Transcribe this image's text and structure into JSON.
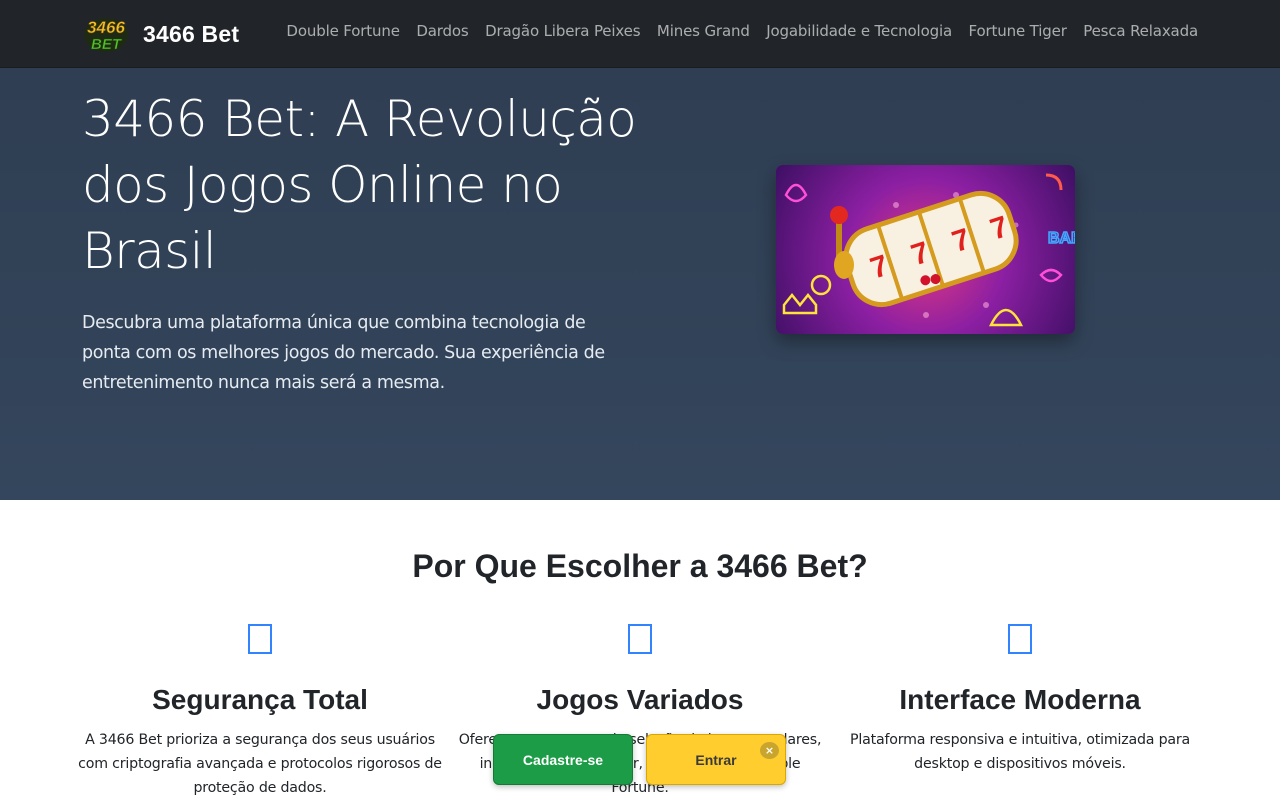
{
  "brand": {
    "logo_text": "3466 BET",
    "name": "3466 Bet"
  },
  "nav": {
    "links": [
      "Double Fortune",
      "Dardos",
      "Dragão Libera Peixes",
      "Mines Grand",
      "Jogabilidade e Tecnologia",
      "Fortune Tiger",
      "Pesca Relaxada"
    ]
  },
  "hero": {
    "title": "3466 Bet: A Revolução dos Jogos Online no Brasil",
    "text": "Descubra uma plataforma única que combina tecnologia de ponta com os melhores jogos do mercado. Sua experiência de entretenimento nunca mais será a mesma."
  },
  "features": {
    "title": "Por Que Escolher a 3466 Bet?",
    "items": [
      {
        "icon": "shield-icon",
        "title": "Segurança Total",
        "desc": "A 3466 Bet prioriza a segurança dos seus usuários com criptografia avançada e protocolos rigorosos de proteção de dados."
      },
      {
        "icon": "controller-icon",
        "title": "Jogos Variados",
        "desc": "Oferecemos uma ampla seleção de jogos populares, incluindo Fortune Tiger, Mines Grand e Double Fortune."
      },
      {
        "icon": "monitor-icon",
        "title": "Interface Moderna",
        "desc": "Plataforma responsiva e intuitiva, otimizada para desktop e dispositivos móveis."
      }
    ]
  },
  "cta": {
    "register": "Cadastre-se",
    "login": "Entrar",
    "close": "×"
  },
  "colors": {
    "navbar": "#212529",
    "hero": "#34465d",
    "register": "#1c9c46",
    "login": "#ffcd2e",
    "icon": "#0d6efd"
  }
}
